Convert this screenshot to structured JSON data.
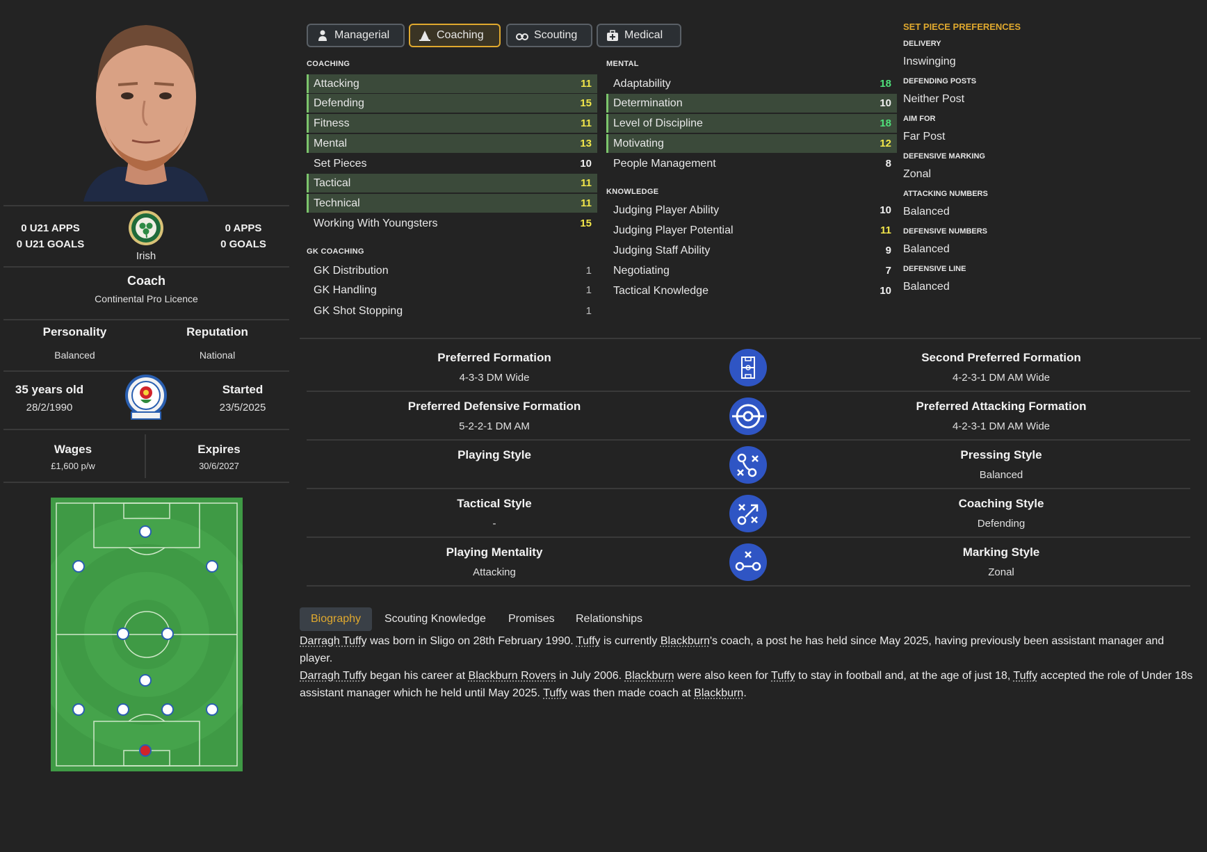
{
  "profile": {
    "u21_apps": "0 U21 APPS",
    "u21_goals": "0 U21 GOALS",
    "apps": "0 APPS",
    "goals": "0 GOALS",
    "nationality": "Irish",
    "role": "Coach",
    "licence": "Continental Pro Licence",
    "personality_label": "Personality",
    "personality": "Balanced",
    "reputation_label": "Reputation",
    "reputation": "National",
    "age": "35 years old",
    "dob": "28/2/1990",
    "started_label": "Started",
    "started": "23/5/2025",
    "wages_label": "Wages",
    "wages": "£1,600 p/w",
    "expires_label": "Expires",
    "expires": "30/6/2027"
  },
  "tabs": [
    {
      "label": "Managerial",
      "icon": "person-icon"
    },
    {
      "label": "Coaching",
      "icon": "cone-icon",
      "active": true
    },
    {
      "label": "Scouting",
      "icon": "binoculars-icon"
    },
    {
      "label": "Medical",
      "icon": "medical-kit-icon"
    }
  ],
  "coaching": {
    "header": "COACHING",
    "items": [
      {
        "name": "Attacking",
        "value": "11",
        "hl": true
      },
      {
        "name": "Defending",
        "value": "15",
        "hl": true
      },
      {
        "name": "Fitness",
        "value": "11",
        "hl": true
      },
      {
        "name": "Mental",
        "value": "13",
        "hl": true
      },
      {
        "name": "Set Pieces",
        "value": "10",
        "hl": false
      },
      {
        "name": "Tactical",
        "value": "11",
        "hl": true
      },
      {
        "name": "Technical",
        "value": "11",
        "hl": true
      },
      {
        "name": "Working With Youngsters",
        "value": "15",
        "hl": false
      }
    ]
  },
  "gk_coaching": {
    "header": "GK COACHING",
    "items": [
      {
        "name": "GK Distribution",
        "value": "1"
      },
      {
        "name": "GK Handling",
        "value": "1"
      },
      {
        "name": "GK Shot Stopping",
        "value": "1"
      }
    ]
  },
  "mental": {
    "header": "MENTAL",
    "items": [
      {
        "name": "Adaptability",
        "value": "18",
        "hl": false
      },
      {
        "name": "Determination",
        "value": "10",
        "hl": true
      },
      {
        "name": "Level of Discipline",
        "value": "18",
        "hl": true
      },
      {
        "name": "Motivating",
        "value": "12",
        "hl": true
      },
      {
        "name": "People Management",
        "value": "8",
        "hl": false
      }
    ]
  },
  "knowledge": {
    "header": "KNOWLEDGE",
    "items": [
      {
        "name": "Judging Player Ability",
        "value": "10"
      },
      {
        "name": "Judging Player Potential",
        "value": "11"
      },
      {
        "name": "Judging Staff Ability",
        "value": "9"
      },
      {
        "name": "Negotiating",
        "value": "7"
      },
      {
        "name": "Tactical Knowledge",
        "value": "10"
      }
    ]
  },
  "set_pieces": {
    "title": "SET PIECE PREFERENCES",
    "items": [
      {
        "label": "DELIVERY",
        "value": "Inswinging"
      },
      {
        "label": "DEFENDING POSTS",
        "value": "Neither Post"
      },
      {
        "label": "AIM FOR",
        "value": "Far Post"
      },
      {
        "label": "DEFENSIVE MARKING",
        "value": "Zonal"
      },
      {
        "label": "ATTACKING NUMBERS",
        "value": "Balanced"
      },
      {
        "label": "DEFENSIVE NUMBERS",
        "value": "Balanced"
      },
      {
        "label": "DEFENSIVE LINE",
        "value": "Balanced"
      }
    ]
  },
  "formations": [
    {
      "left_title": "Preferred Formation",
      "left_value": "4-3-3 DM Wide",
      "icon": "pitch-icon",
      "right_title": "Second Preferred Formation",
      "right_value": "4-2-3-1 DM AM Wide"
    },
    {
      "left_title": "Preferred Defensive Formation",
      "left_value": "5-2-2-1 DM AM",
      "icon": "target-icon",
      "right_title": "Preferred Attacking Formation",
      "right_value": "4-2-3-1 DM AM Wide"
    },
    {
      "left_title": "Playing Style",
      "left_value": "",
      "icon": "tactics-icon",
      "right_title": "Pressing Style",
      "right_value": "Balanced"
    },
    {
      "left_title": "Tactical Style",
      "left_value": "-",
      "icon": "tactics-arrow-icon",
      "right_title": "Coaching Style",
      "right_value": "Defending"
    },
    {
      "left_title": "Playing Mentality",
      "left_value": "Attacking",
      "icon": "mentality-icon",
      "right_title": "Marking Style",
      "right_value": "Zonal"
    }
  ],
  "bio_tabs": [
    "Biography",
    "Scouting Knowledge",
    "Promises",
    "Relationships"
  ],
  "bio": {
    "p1": [
      "Darragh Tuffy",
      " was born in Sligo on 28th February 1990. ",
      "Tuffy",
      " is currently ",
      "Blackburn",
      "'s coach, a post he has held since May 2025, having previously been assistant manager and player."
    ],
    "p2": [
      "Darragh Tuffy",
      " began his career at ",
      "Blackburn Rovers",
      " in July 2006. ",
      "Blackburn",
      " were also keen for ",
      "Tuffy",
      " to stay in football and, at the age of just 18, ",
      "Tuffy",
      " accepted the role of Under 18s assistant manager which he held until May 2025. ",
      "Tuffy",
      " was then made coach at ",
      "Blackburn",
      "."
    ]
  },
  "colors": {
    "accent": "#e0a92e",
    "highlight_row": "#3b4a3a",
    "value_good": "#4fe07a",
    "value_mid": "#f2e64a",
    "icon_blue": "#2f55c4",
    "pitch": "#3f9a45"
  }
}
